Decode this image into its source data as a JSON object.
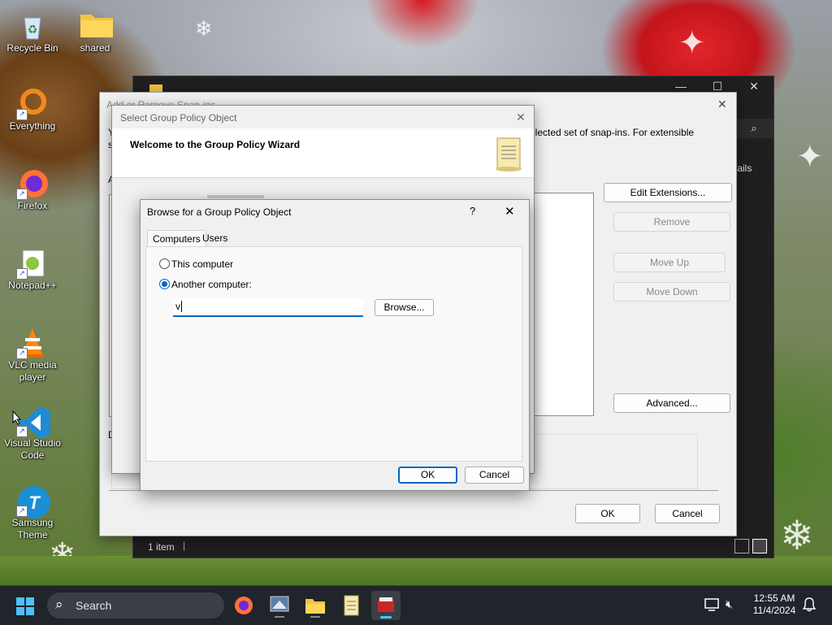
{
  "desktop": {
    "icons": [
      {
        "label": "Recycle Bin"
      },
      {
        "label": "shared"
      },
      {
        "label": "Everything"
      },
      {
        "label": "Firefox"
      },
      {
        "label": "Notepad++"
      },
      {
        "label": "VLC media player"
      },
      {
        "label": "Visual Studio Code"
      },
      {
        "label": "Samsung Theme"
      }
    ]
  },
  "explorer": {
    "status_count": "1 item",
    "partial_details": "tails"
  },
  "snapins": {
    "title": "Add or Remove Snap-ins",
    "desc_partial": "elected set of snap-ins. For extensible",
    "left_partial_y": "Y",
    "left_partial_s": "s",
    "left_partial_a": "A",
    "left_partial_d": "D",
    "buttons": {
      "edit_extensions": "Edit Extensions...",
      "remove": "Remove",
      "move_up": "Move Up",
      "move_down": "Move Down",
      "advanced": "Advanced...",
      "ok": "OK",
      "cancel": "Cancel"
    }
  },
  "wizard": {
    "title": "Select Group Policy Object",
    "heading": "Welcome to the Group Policy Wizard"
  },
  "browse": {
    "title": "Browse for a Group Policy Object",
    "help": "?",
    "tabs": [
      "Computers",
      "Users"
    ],
    "radio_this": "This computer",
    "radio_another": "Another computer:",
    "computer_value": "v",
    "browse_button": "Browse...",
    "ok": "OK",
    "cancel": "Cancel"
  },
  "taskbar": {
    "search_placeholder": "Search",
    "time": "12:55 AM",
    "date": "11/4/2024"
  },
  "colors": {
    "accent": "#0067c0",
    "taskbar": "#20242b"
  }
}
